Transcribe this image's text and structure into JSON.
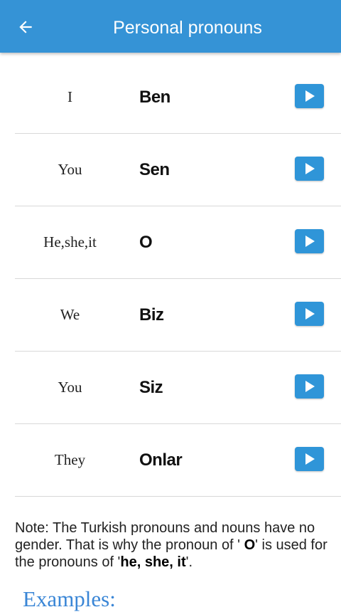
{
  "header": {
    "title": "Personal pronouns",
    "back_icon": "arrow-left-icon"
  },
  "pronouns": [
    {
      "english": "I",
      "turkish": "Ben"
    },
    {
      "english": "You",
      "turkish": "Sen"
    },
    {
      "english": "He,she,it",
      "turkish": "O"
    },
    {
      "english": "We",
      "turkish": "Biz"
    },
    {
      "english": "You",
      "turkish": "Siz"
    },
    {
      "english": "They",
      "turkish": "Onlar"
    }
  ],
  "note": {
    "part1": "Note: The Turkish pronouns and nouns have no gender. That is why the pronoun of ' ",
    "pronoun": "O",
    "part2": "' is used for the pronouns of '",
    "pronouns": "he, she, it",
    "part3": "'."
  },
  "examples": {
    "title": "Examples:"
  },
  "colors": {
    "accent": "#3593d6",
    "play_button": "#2f95d8",
    "examples_title": "#3a86d6"
  }
}
